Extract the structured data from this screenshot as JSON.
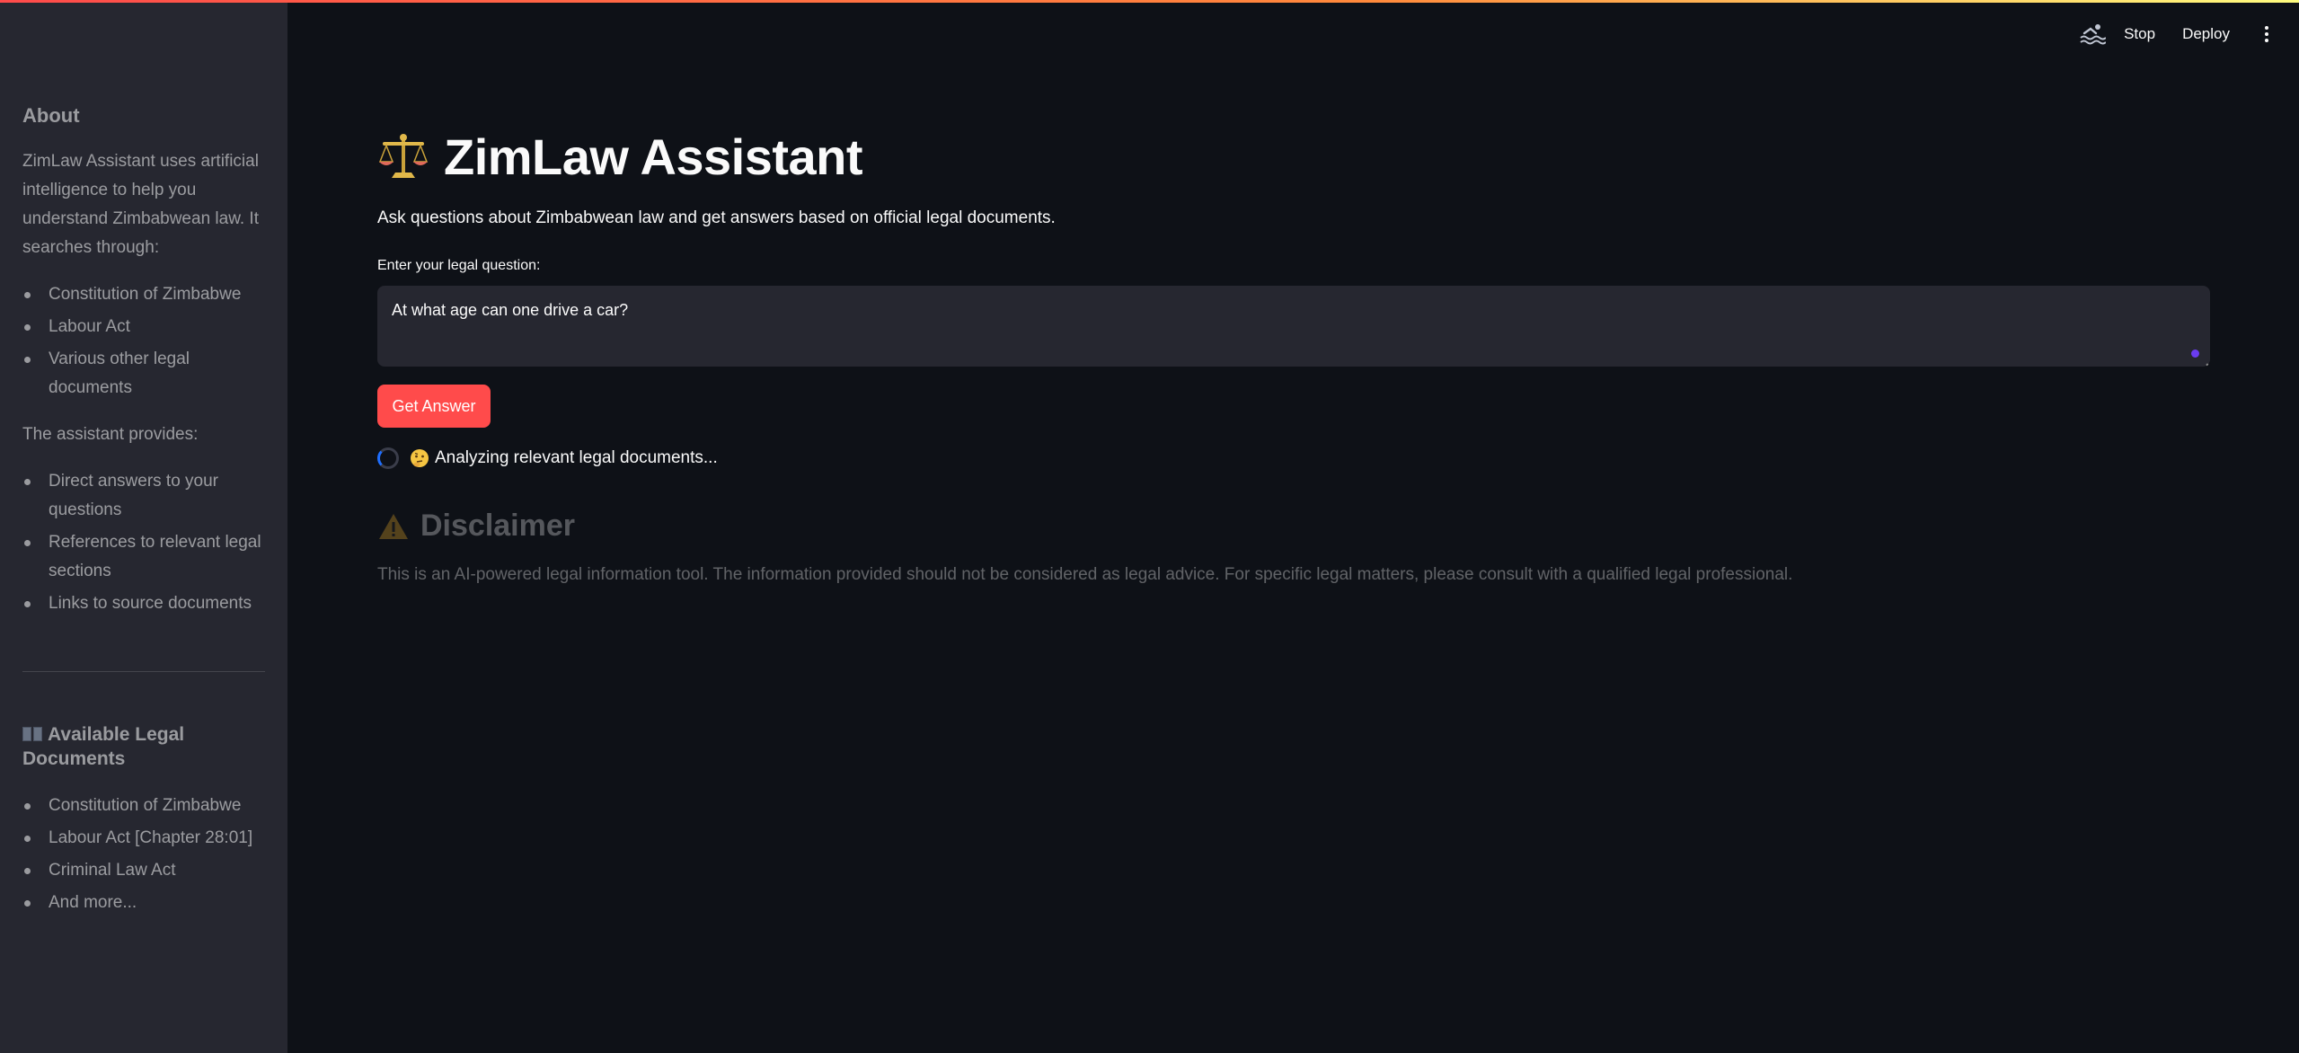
{
  "header": {
    "status_icon": "swimmer-icon",
    "stop_label": "Stop",
    "deploy_label": "Deploy",
    "menu_icon": "kebab-menu-icon",
    "accent_gradient": [
      "#ff4b4b",
      "#fffd80"
    ]
  },
  "sidebar": {
    "about_heading": "About",
    "about_text": "ZimLaw Assistant uses artificial intelligence to help you understand Zimbabwean law. It searches through:",
    "sources": [
      "Constitution of Zimbabwe",
      "Labour Act",
      "Various other legal documents"
    ],
    "provides_text": "The assistant provides:",
    "provides": [
      "Direct answers to your questions",
      "References to relevant legal sections",
      "Links to source documents"
    ],
    "available_heading": "Available Legal Documents",
    "available_icon": "open-book-icon",
    "available_docs": [
      "Constitution of Zimbabwe",
      "Labour Act [Chapter 28:01]",
      "Criminal Law Act",
      "And more..."
    ]
  },
  "main": {
    "title_icon": "balance-scale-icon",
    "title": "ZimLaw Assistant",
    "subtitle": "Ask questions about Zimbabwean law and get answers based on official legal documents.",
    "question_label": "Enter your legal question:",
    "question_value": "At what age can one drive a car?",
    "submit_label": "Get Answer",
    "status_icon": "thinking-face-icon",
    "status_text": "Analyzing relevant legal documents...",
    "disclaimer_icon": "warning-icon",
    "disclaimer_title": "Disclaimer",
    "disclaimer_text": "This is an AI-powered legal information tool. The information provided should not be considered as legal advice. For specific legal matters, please consult with a qualified legal professional."
  },
  "colors": {
    "background": "#0e1117",
    "sidebar": "#262730",
    "primary_button": "#ff4b4b",
    "text": "#fafafa"
  }
}
